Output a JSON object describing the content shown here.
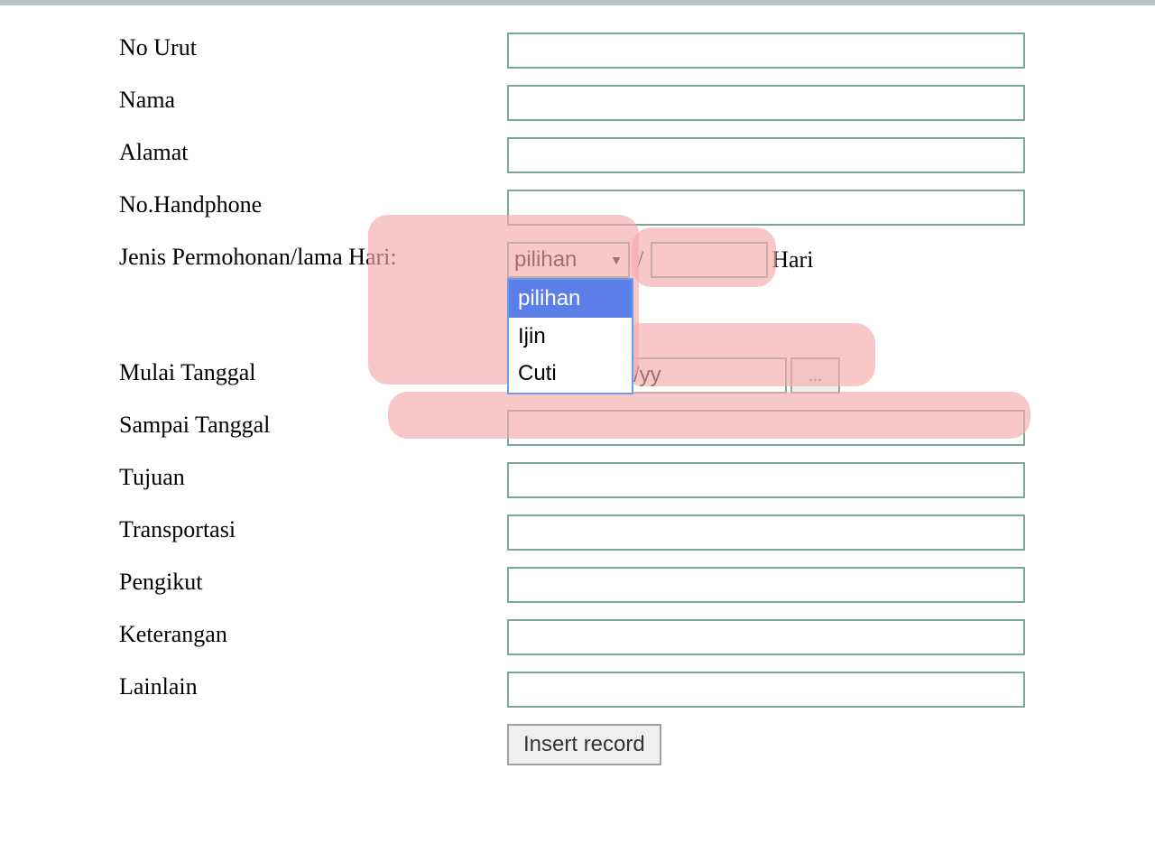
{
  "form": {
    "no_urut": {
      "label": "No Urut",
      "value": ""
    },
    "nama": {
      "label": "Nama",
      "value": ""
    },
    "alamat": {
      "label": "Alamat",
      "value": ""
    },
    "no_handphone": {
      "label": "No.Handphone",
      "value": ""
    },
    "jenis_permohonan": {
      "label": "Jenis Permohonan/lama Hari:",
      "selected": "pilihan",
      "options": [
        "pilihan",
        "Ijin",
        "Cuti"
      ],
      "days_value": "",
      "days_suffix": "Hari",
      "separator": "/"
    },
    "mulai_tanggal": {
      "label": "Mulai Tanggal",
      "placeholder": "/yy",
      "button": "..."
    },
    "sampai_tanggal": {
      "label": "Sampai Tanggal",
      "value": ""
    },
    "tujuan": {
      "label": "Tujuan",
      "value": ""
    },
    "transportasi": {
      "label": "Transportasi",
      "value": ""
    },
    "pengikut": {
      "label": "Pengikut",
      "value": ""
    },
    "keterangan": {
      "label": "Keterangan",
      "value": ""
    },
    "lainlain": {
      "label": "Lainlain",
      "value": ""
    },
    "submit": {
      "label": "Insert record"
    }
  }
}
